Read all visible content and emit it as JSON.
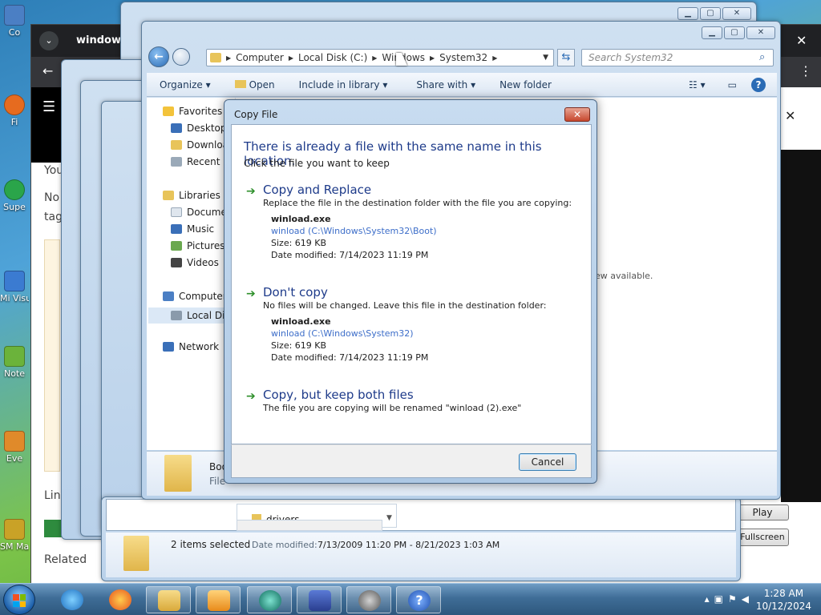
{
  "desktop": {
    "icons": [
      {
        "label": "Co"
      },
      {
        "label": "Fi"
      },
      {
        "label": "Supe"
      },
      {
        "label": "Mi Visua"
      },
      {
        "label": "Note"
      },
      {
        "label": "Eve"
      },
      {
        "label": "SM Ma"
      }
    ]
  },
  "browser": {
    "tab_title": "window",
    "page_fragments": [
      "You",
      "No",
      "tag",
      "Lin",
      "Related"
    ],
    "right_panel": {
      "preview_text": "ew available.",
      "play_label": "Play",
      "fullscreen_label": "Fullscreen"
    }
  },
  "explorer": {
    "breadcrumb": [
      "Computer",
      "Local Disk (C:)",
      "Windows",
      "System32"
    ],
    "search_placeholder": "Search System32",
    "toolbar": {
      "organize": "Organize",
      "open": "Open",
      "include_in_library": "Include in library",
      "share_with": "Share with",
      "new_folder": "New folder"
    },
    "nav": {
      "favorites": "Favorites",
      "desktop": "Desktop",
      "downloads": "Download",
      "recent": "Recent P",
      "libraries": "Libraries",
      "documents": "Docume",
      "music": "Music",
      "pictures": "Pictures",
      "videos": "Videos",
      "computer": "Computer",
      "local_disk": "Local Dis",
      "network": "Network"
    },
    "details": {
      "name": "Boo",
      "type": "File"
    }
  },
  "bottom_explorer": {
    "folder_item": "drivers",
    "status": "2 items selected",
    "date_label": "Date modified:",
    "date_range": "7/13/2009 11:20 PM - 8/21/2023 1:03 AM"
  },
  "dialog": {
    "title": "Copy File",
    "close_label": "✕",
    "heading": "There is already a file with the same name in this location.",
    "subheading": "Click the file you want to keep",
    "options": [
      {
        "title": "Copy and Replace",
        "description": "Replace the file in the destination folder with the file you are copying:",
        "file": {
          "name": "winload.exe",
          "path": "winload (C:\\Windows\\System32\\Boot)",
          "size": "Size: 619 KB",
          "modified": "Date modified: 7/14/2023 11:19 PM"
        }
      },
      {
        "title": "Don't copy",
        "description": "No files will be changed. Leave this file in the destination folder:",
        "file": {
          "name": "winload.exe",
          "path": "winload (C:\\Windows\\System32)",
          "size": "Size: 619 KB",
          "modified": "Date modified: 7/14/2023 11:19 PM"
        }
      },
      {
        "title": "Copy, but keep both files",
        "description": "The file you are copying will be renamed \"winload (2).exe\""
      }
    ],
    "cancel_label": "Cancel"
  },
  "taskbar": {
    "time": "1:28 AM",
    "date": "10/12/2024",
    "apps": [
      "internet-explorer",
      "firefox",
      "file-explorer",
      "media-player",
      "app-circle",
      "checklist",
      "network-tool",
      "help"
    ]
  }
}
